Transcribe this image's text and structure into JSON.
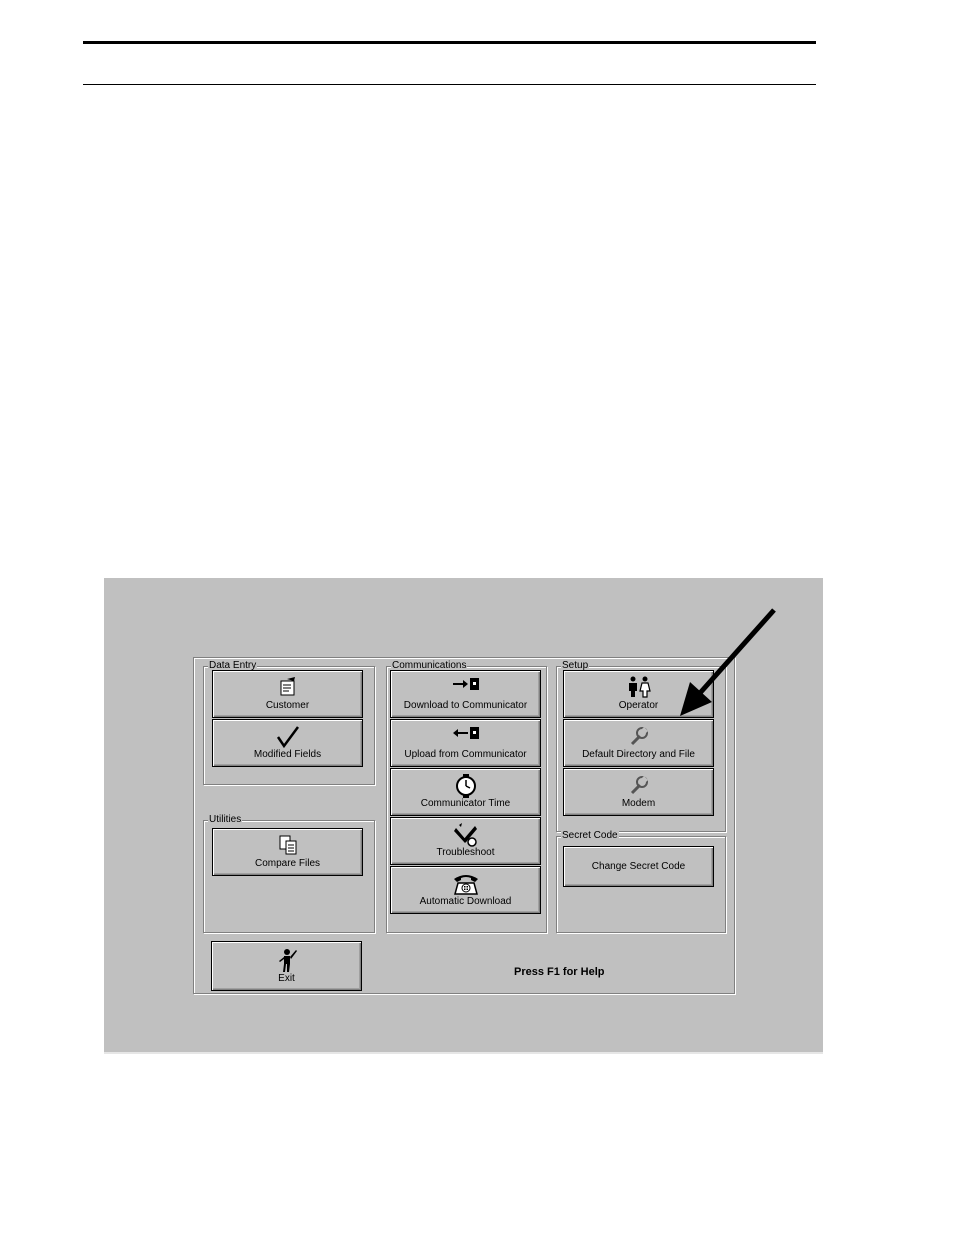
{
  "groups": {
    "data_entry": "Data Entry",
    "utilities": "Utilities",
    "communications": "Communications",
    "setup": "Setup",
    "secret_code": "Secret Code"
  },
  "buttons": {
    "customer": "Customer",
    "modified_fields": "Modified Fields",
    "compare_files": "Compare Files",
    "download": "Download to Communicator",
    "upload": "Upload from Communicator",
    "comm_time": "Communicator Time",
    "troubleshoot": "Troubleshoot",
    "auto_download": "Automatic Download",
    "operator": "Operator",
    "default_dir": "Default Directory and File",
    "modem": "Modem",
    "change_secret": "Change Secret Code",
    "exit": "Exit"
  },
  "help_text": "Press F1 for Help",
  "icons": {
    "customer": "notepad-icon",
    "modified_fields": "checkmark-icon",
    "compare_files": "documents-icon",
    "download": "arrow-right-icon",
    "upload": "arrow-left-icon",
    "comm_time": "clock-icon",
    "troubleshoot": "tools-icon",
    "auto_download": "telephone-icon",
    "operator": "people-icon",
    "default_dir": "wrench-icon",
    "modem": "wrench-icon",
    "exit": "person-exit-icon"
  }
}
